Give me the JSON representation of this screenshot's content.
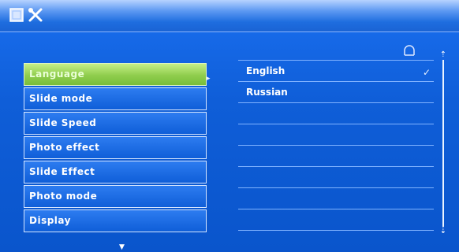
{
  "window": {
    "icons": [
      "settings-icon-square",
      "tools-icon"
    ]
  },
  "menu": {
    "items": [
      {
        "label": "Language",
        "selected": true
      },
      {
        "label": "Slide mode",
        "selected": false
      },
      {
        "label": "Slide Speed",
        "selected": false
      },
      {
        "label": "Photo effect",
        "selected": false
      },
      {
        "label": "Slide Effect",
        "selected": false
      },
      {
        "label": "Photo mode",
        "selected": false
      },
      {
        "label": "Display",
        "selected": false
      }
    ]
  },
  "options": {
    "items": [
      "English",
      "Russian",
      "",
      "",
      "",
      "",
      "",
      "",
      ""
    ],
    "checked_index": 0,
    "check_glyph": "✓"
  },
  "scrollbar": {
    "up_glyph": "⇡",
    "down_glyph": "⇣"
  },
  "indicators": {
    "menu_pointer_glyph": "▸",
    "more_below_glyph": "▼"
  }
}
